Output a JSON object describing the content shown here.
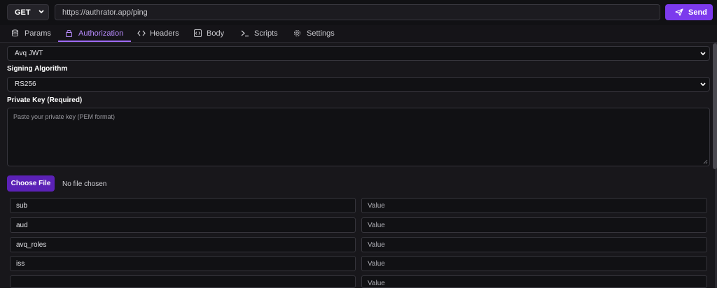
{
  "request": {
    "method": "GET",
    "url": "https://authrator.app/ping",
    "send_label": "Send"
  },
  "tabs": [
    {
      "label": "Params",
      "icon": "database-icon"
    },
    {
      "label": "Authorization",
      "icon": "lock-icon",
      "active": true
    },
    {
      "label": "Headers",
      "icon": "code-icon"
    },
    {
      "label": "Body",
      "icon": "box-code-icon"
    },
    {
      "label": "Scripts",
      "icon": "terminal-icon"
    },
    {
      "label": "Settings",
      "icon": "gear-icon"
    }
  ],
  "auth": {
    "type_value": "Avq JWT",
    "signing_label": "Signing Algorithm",
    "signing_value": "RS256",
    "private_key_label": "Private Key (Required)",
    "private_key_placeholder": "Paste your private key (PEM format)",
    "choose_file_label": "Choose File",
    "no_file_text": "No file chosen"
  },
  "claims": [
    {
      "key": "sub",
      "value": "Value"
    },
    {
      "key": "aud",
      "value": "Value"
    },
    {
      "key": "avq_roles",
      "value": "Value"
    },
    {
      "key": "iss",
      "value": "Value"
    },
    {
      "key": "",
      "value": "Value"
    }
  ],
  "colors": {
    "accent": "#7c3aed",
    "accent_dark": "#5b21b6",
    "active_tab": "#b98cff",
    "background": "#18171b"
  }
}
